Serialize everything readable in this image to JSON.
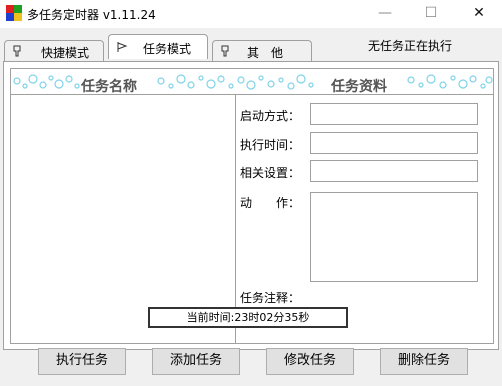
{
  "window": {
    "title": "多任务定时器 v1.11.24",
    "min_glyph": "—",
    "max_glyph": "☐",
    "close_glyph": "✕"
  },
  "tabs": [
    {
      "label": "快捷模式",
      "icon": "pin-icon",
      "active": false
    },
    {
      "label": "任务模式",
      "icon": "flag-icon",
      "active": true
    },
    {
      "label": "其　他",
      "icon": "pin-icon",
      "active": false
    }
  ],
  "status": "无任务正在执行",
  "headers": {
    "task_name": "任务名称",
    "task_info": "任务资料"
  },
  "form": {
    "start_mode_label": "启动方式：",
    "exec_time_label": "执行时间：",
    "settings_label": "相关设置：",
    "action_label": "动　　作：",
    "note_label": "任务注释："
  },
  "clock": {
    "text": "当前时间:23时02分35秒"
  },
  "buttons": {
    "execute": "执行任务",
    "add": "添加任务",
    "modify": "修改任务",
    "delete": "删除任务"
  },
  "colors": {
    "bubble": "#7fd3e8",
    "border": "#a0a0a0",
    "button_bg": "#e1e1e1"
  }
}
